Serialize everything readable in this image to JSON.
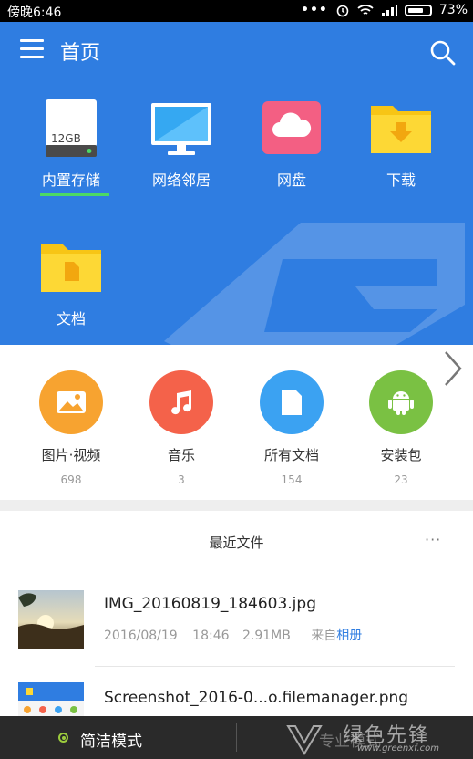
{
  "status_bar": {
    "time": "傍晚6:46",
    "battery": "73%"
  },
  "header": {
    "title": "首页"
  },
  "locations": [
    {
      "label": "内置存储",
      "storage_text": "12GB"
    },
    {
      "label": "网络邻居"
    },
    {
      "label": "网盘"
    },
    {
      "label": "下载"
    },
    {
      "label": "文档"
    }
  ],
  "categories": [
    {
      "label": "图片·视频",
      "count": "698"
    },
    {
      "label": "音乐",
      "count": "3"
    },
    {
      "label": "所有文档",
      "count": "154"
    },
    {
      "label": "安装包",
      "count": "23"
    }
  ],
  "recent": {
    "title": "最近文件",
    "more": "···",
    "files": [
      {
        "name": "IMG_20160819_184603.jpg",
        "date": "2016/08/19",
        "time": "18:46",
        "size": "2.91MB",
        "source_prefix": "来自",
        "source": "相册"
      },
      {
        "name": "Screenshot_2016-0...o.filemanager.png"
      }
    ]
  },
  "bottom_bar": {
    "simple_mode": "简洁模式",
    "pro_mode": "专业模式"
  },
  "watermark": {
    "text": "绿色先锋",
    "url": "www.greenxf.com"
  },
  "colors": {
    "accent": "#2f7de1",
    "selected_underline": "#4cd964",
    "bottom_bar": "#2a2a2a"
  }
}
